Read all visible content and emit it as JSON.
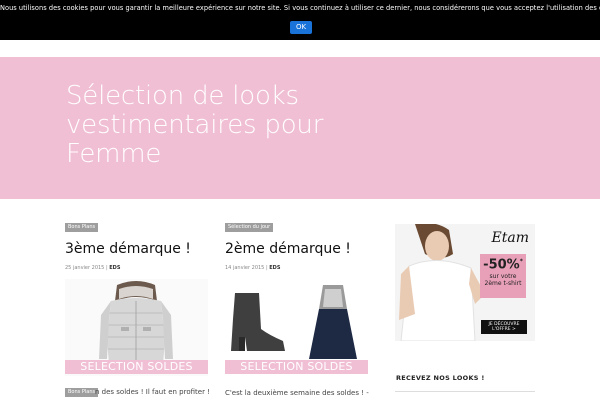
{
  "cookie_bar": {
    "message": "Nous utilisons des cookies pour vous garantir la meilleure expérience sur notre site. Si vous continuez à utiliser ce dernier, nous considérerons que vous acceptez l'utilisation des cookies.",
    "ok_label": "OK"
  },
  "hero": {
    "title": "Sélection de looks vestimentaires pour Femme"
  },
  "posts": [
    {
      "category": "Bons Plans",
      "title": "3ème démarque !",
      "date": "25 janvier 2015",
      "separator": " | ",
      "author": "EDS",
      "banner": "SELECTION SOLDES",
      "excerpt": "n des soldes ! Il faut en profiter !",
      "next_category": "Bons Plans"
    },
    {
      "category": "Sélection du jour",
      "title": "2ème démarque !",
      "date": "14 janvier 2015",
      "separator": " | ",
      "author": "EDS",
      "banner": "SELECTION SOLDES",
      "excerpt": "C'est la deuxième semaine des soldes ! -"
    }
  ],
  "sidebar": {
    "ad": {
      "brand": "Etam",
      "percent": "-50%",
      "asterisk": "*",
      "line1": "sur votre",
      "line2": "2ème t-shirt",
      "cta_line1": "JE DÉCOUVRE",
      "cta_line2": "L'OFFRE >"
    },
    "newsletter_title": "RECEVEZ NOS LOOKS !"
  },
  "colors": {
    "hero_pink": "#f0bfd4",
    "cookie_bg": "#000000",
    "ok_button": "#1a73d9",
    "tag_gray": "#9e9e9e"
  }
}
